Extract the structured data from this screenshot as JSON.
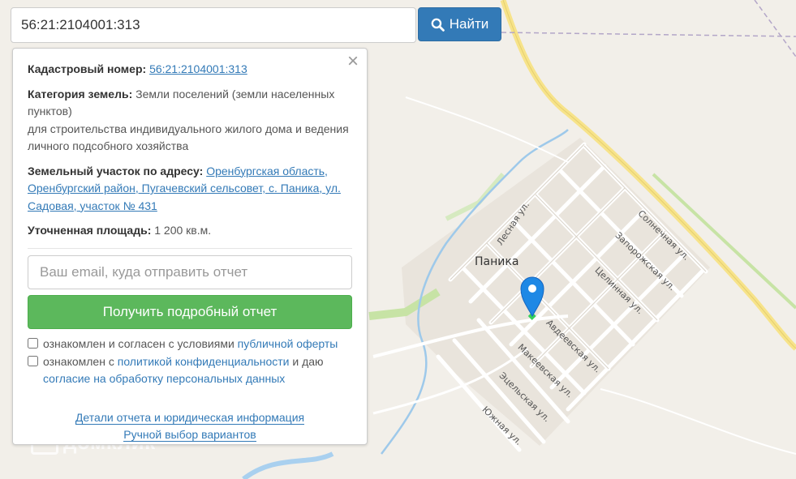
{
  "search": {
    "value": "56:21:2104001:313",
    "button_label": "Найти"
  },
  "map": {
    "town_name": "Паника",
    "streets": {
      "lesnaya": "Лесная ул.",
      "solnechnaya": "Солнечная ул.",
      "zaporozhskaya": "Запорожская ул.",
      "tselinnaya": "Целинная ул.",
      "avdeevskaya": "Авдеевская ул.",
      "makeevskaya": "Макеевская ул.",
      "etselskaya": "Эцельская ул.",
      "yuzhnaya": "Южная ул."
    },
    "watermark": "домклик"
  },
  "panel": {
    "close_label": "×",
    "cadastral_label": "Кадастровый номер:",
    "cadastral_value": "56:21:2104001:313",
    "category_label": "Категория земель:",
    "category_value_line1": " Земли поселений (земли населенных пунктов)",
    "category_value_line2": "для строительства индивидуального жилого дома и ведения личного подсобного хозяйства",
    "address_label": "Земельный участок по адресу:",
    "address_value": "Оренбургская область, Оренбургский район, Пугачевский сельсовет, с. Паника, ул. Садовая, участок № 431",
    "area_label": "Уточненная площадь:",
    "area_value": " 1 200 кв.м.",
    "email_placeholder": "Ваш email, куда отправить отчет",
    "report_button": "Получить подробный отчет",
    "consent1_text": "ознакомлен и согласен с условиями ",
    "consent1_link": "публичной оферты",
    "consent2_text": "ознакомлен с ",
    "consent2_link": "политикой конфиденциальности",
    "consent2_text2": " и даю",
    "consent2_link2": "согласие на обработку персональных данных",
    "footer_link1": "Детали отчета и юридическая информация",
    "footer_link2": "Ручной выбор вариантов"
  },
  "colors": {
    "primary": "#337ab7",
    "success": "#5cb85c",
    "marker": "#1e88e5",
    "map_bg": "#f2efe9"
  }
}
